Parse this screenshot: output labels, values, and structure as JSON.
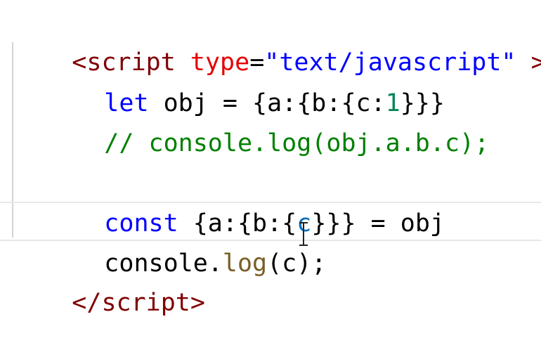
{
  "code": {
    "l1": {
      "open_bracket": "<",
      "tag_name": "script",
      "space": " ",
      "attr_name": "type",
      "equals": "=",
      "attr_value": "\"text/javascript\"",
      "close_bracket": " >"
    },
    "l2": {
      "keyword": "let",
      "rest_pre": " obj = {a:{b:{c:",
      "number": "1",
      "rest_post": "}}}"
    },
    "l3": {
      "comment": "// console.log(obj.a.b.c);"
    },
    "l5": {
      "keyword": "const",
      "rest_pre": " {a:{b:{",
      "var": "c",
      "rest_post": "}}} = obj"
    },
    "l6": {
      "obj": "console.",
      "fn": "log",
      "args": "(c);"
    },
    "l7": {
      "open_bracket": "</",
      "tag_name": "script",
      "close_bracket": ">"
    }
  },
  "colors": {
    "tag": "#800000",
    "attribute": "#e50000",
    "string": "#0000ff",
    "keyword": "#0000ff",
    "number": "#098658",
    "comment": "#008000"
  },
  "icons": {
    "cursor": "text-cursor-icon"
  }
}
